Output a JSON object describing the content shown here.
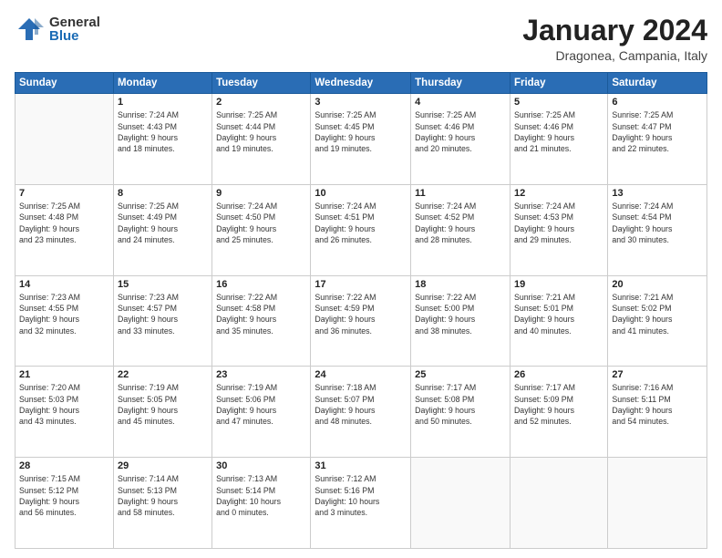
{
  "logo": {
    "general": "General",
    "blue": "Blue"
  },
  "title": "January 2024",
  "location": "Dragonea, Campania, Italy",
  "days_header": [
    "Sunday",
    "Monday",
    "Tuesday",
    "Wednesday",
    "Thursday",
    "Friday",
    "Saturday"
  ],
  "weeks": [
    [
      {
        "day": "",
        "info": ""
      },
      {
        "day": "1",
        "info": "Sunrise: 7:24 AM\nSunset: 4:43 PM\nDaylight: 9 hours\nand 18 minutes."
      },
      {
        "day": "2",
        "info": "Sunrise: 7:25 AM\nSunset: 4:44 PM\nDaylight: 9 hours\nand 19 minutes."
      },
      {
        "day": "3",
        "info": "Sunrise: 7:25 AM\nSunset: 4:45 PM\nDaylight: 9 hours\nand 19 minutes."
      },
      {
        "day": "4",
        "info": "Sunrise: 7:25 AM\nSunset: 4:46 PM\nDaylight: 9 hours\nand 20 minutes."
      },
      {
        "day": "5",
        "info": "Sunrise: 7:25 AM\nSunset: 4:46 PM\nDaylight: 9 hours\nand 21 minutes."
      },
      {
        "day": "6",
        "info": "Sunrise: 7:25 AM\nSunset: 4:47 PM\nDaylight: 9 hours\nand 22 minutes."
      }
    ],
    [
      {
        "day": "7",
        "info": "Sunrise: 7:25 AM\nSunset: 4:48 PM\nDaylight: 9 hours\nand 23 minutes."
      },
      {
        "day": "8",
        "info": "Sunrise: 7:25 AM\nSunset: 4:49 PM\nDaylight: 9 hours\nand 24 minutes."
      },
      {
        "day": "9",
        "info": "Sunrise: 7:24 AM\nSunset: 4:50 PM\nDaylight: 9 hours\nand 25 minutes."
      },
      {
        "day": "10",
        "info": "Sunrise: 7:24 AM\nSunset: 4:51 PM\nDaylight: 9 hours\nand 26 minutes."
      },
      {
        "day": "11",
        "info": "Sunrise: 7:24 AM\nSunset: 4:52 PM\nDaylight: 9 hours\nand 28 minutes."
      },
      {
        "day": "12",
        "info": "Sunrise: 7:24 AM\nSunset: 4:53 PM\nDaylight: 9 hours\nand 29 minutes."
      },
      {
        "day": "13",
        "info": "Sunrise: 7:24 AM\nSunset: 4:54 PM\nDaylight: 9 hours\nand 30 minutes."
      }
    ],
    [
      {
        "day": "14",
        "info": "Sunrise: 7:23 AM\nSunset: 4:55 PM\nDaylight: 9 hours\nand 32 minutes."
      },
      {
        "day": "15",
        "info": "Sunrise: 7:23 AM\nSunset: 4:57 PM\nDaylight: 9 hours\nand 33 minutes."
      },
      {
        "day": "16",
        "info": "Sunrise: 7:22 AM\nSunset: 4:58 PM\nDaylight: 9 hours\nand 35 minutes."
      },
      {
        "day": "17",
        "info": "Sunrise: 7:22 AM\nSunset: 4:59 PM\nDaylight: 9 hours\nand 36 minutes."
      },
      {
        "day": "18",
        "info": "Sunrise: 7:22 AM\nSunset: 5:00 PM\nDaylight: 9 hours\nand 38 minutes."
      },
      {
        "day": "19",
        "info": "Sunrise: 7:21 AM\nSunset: 5:01 PM\nDaylight: 9 hours\nand 40 minutes."
      },
      {
        "day": "20",
        "info": "Sunrise: 7:21 AM\nSunset: 5:02 PM\nDaylight: 9 hours\nand 41 minutes."
      }
    ],
    [
      {
        "day": "21",
        "info": "Sunrise: 7:20 AM\nSunset: 5:03 PM\nDaylight: 9 hours\nand 43 minutes."
      },
      {
        "day": "22",
        "info": "Sunrise: 7:19 AM\nSunset: 5:05 PM\nDaylight: 9 hours\nand 45 minutes."
      },
      {
        "day": "23",
        "info": "Sunrise: 7:19 AM\nSunset: 5:06 PM\nDaylight: 9 hours\nand 47 minutes."
      },
      {
        "day": "24",
        "info": "Sunrise: 7:18 AM\nSunset: 5:07 PM\nDaylight: 9 hours\nand 48 minutes."
      },
      {
        "day": "25",
        "info": "Sunrise: 7:17 AM\nSunset: 5:08 PM\nDaylight: 9 hours\nand 50 minutes."
      },
      {
        "day": "26",
        "info": "Sunrise: 7:17 AM\nSunset: 5:09 PM\nDaylight: 9 hours\nand 52 minutes."
      },
      {
        "day": "27",
        "info": "Sunrise: 7:16 AM\nSunset: 5:11 PM\nDaylight: 9 hours\nand 54 minutes."
      }
    ],
    [
      {
        "day": "28",
        "info": "Sunrise: 7:15 AM\nSunset: 5:12 PM\nDaylight: 9 hours\nand 56 minutes."
      },
      {
        "day": "29",
        "info": "Sunrise: 7:14 AM\nSunset: 5:13 PM\nDaylight: 9 hours\nand 58 minutes."
      },
      {
        "day": "30",
        "info": "Sunrise: 7:13 AM\nSunset: 5:14 PM\nDaylight: 10 hours\nand 0 minutes."
      },
      {
        "day": "31",
        "info": "Sunrise: 7:12 AM\nSunset: 5:16 PM\nDaylight: 10 hours\nand 3 minutes."
      },
      {
        "day": "",
        "info": ""
      },
      {
        "day": "",
        "info": ""
      },
      {
        "day": "",
        "info": ""
      }
    ]
  ]
}
